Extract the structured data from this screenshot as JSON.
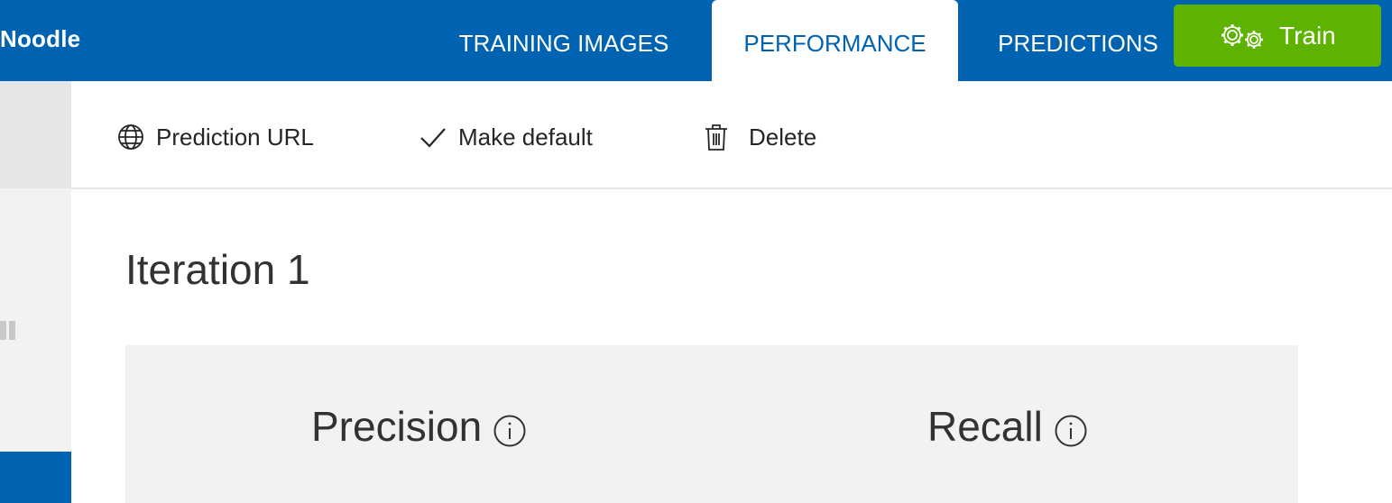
{
  "header": {
    "project_name": "Noodle",
    "tabs": [
      {
        "label": "TRAINING IMAGES",
        "active": false
      },
      {
        "label": "PERFORMANCE",
        "active": true
      },
      {
        "label": "PREDICTIONS",
        "active": false
      }
    ],
    "train_button": {
      "label": "Train",
      "icon": "gears-icon",
      "color": "#5db300"
    },
    "background_color": "#0063b1"
  },
  "toolbar": {
    "commands": [
      {
        "label": "Prediction URL",
        "icon": "globe-icon"
      },
      {
        "label": "Make default",
        "icon": "checkmark-icon"
      },
      {
        "label": "Delete",
        "icon": "trash-icon"
      }
    ]
  },
  "main": {
    "iteration_title": "Iteration 1",
    "metrics": [
      {
        "label": "Precision",
        "icon": "info-icon"
      },
      {
        "label": "Recall",
        "icon": "info-icon"
      }
    ]
  }
}
